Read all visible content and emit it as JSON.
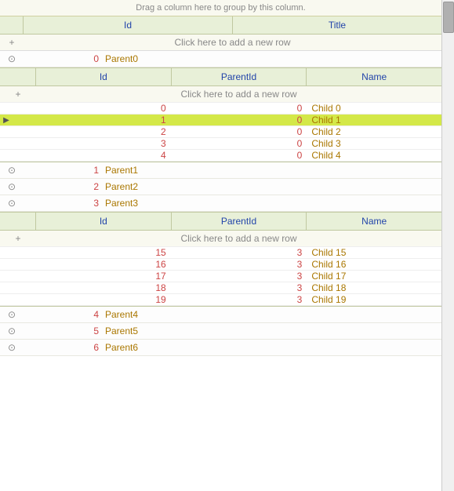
{
  "drag_header": "Drag a column here to group by this column.",
  "outer_columns": {
    "col1": "Id",
    "col2": "Title"
  },
  "add_row_text": "Click here to add a new row",
  "parent_rows": [
    {
      "id": 0,
      "title": "Parent0",
      "expanded": true,
      "children": [
        {
          "id": 0,
          "parentId": 0,
          "name": "Child 0",
          "selected": false
        },
        {
          "id": 1,
          "parentId": 0,
          "name": "Child 1",
          "selected": true
        },
        {
          "id": 2,
          "parentId": 0,
          "name": "Child 2",
          "selected": false
        },
        {
          "id": 3,
          "parentId": 0,
          "name": "Child 3",
          "selected": false
        },
        {
          "id": 4,
          "parentId": 0,
          "name": "Child 4",
          "selected": false
        }
      ]
    },
    {
      "id": 1,
      "title": "Parent1",
      "expanded": false,
      "children": []
    },
    {
      "id": 2,
      "title": "Parent2",
      "expanded": false,
      "children": []
    },
    {
      "id": 3,
      "title": "Parent3",
      "expanded": true,
      "children": [
        {
          "id": 15,
          "parentId": 3,
          "name": "Child 15",
          "selected": false
        },
        {
          "id": 16,
          "parentId": 3,
          "name": "Child 16",
          "selected": false
        },
        {
          "id": 17,
          "parentId": 3,
          "name": "Child 17",
          "selected": false
        },
        {
          "id": 18,
          "parentId": 3,
          "name": "Child 18",
          "selected": false
        },
        {
          "id": 19,
          "parentId": 3,
          "name": "Child 19",
          "selected": false
        }
      ]
    },
    {
      "id": 4,
      "title": "Parent4",
      "expanded": false,
      "children": []
    },
    {
      "id": 5,
      "title": "Parent5",
      "expanded": false,
      "children": []
    },
    {
      "id": 6,
      "title": "Parent6",
      "expanded": false,
      "children": []
    }
  ],
  "child_columns": {
    "id": "Id",
    "parentId": "ParentId",
    "name": "Name"
  },
  "icons": {
    "expand": "⊙",
    "collapse": "⊙",
    "plus": "+",
    "arrow_right": "▶"
  }
}
